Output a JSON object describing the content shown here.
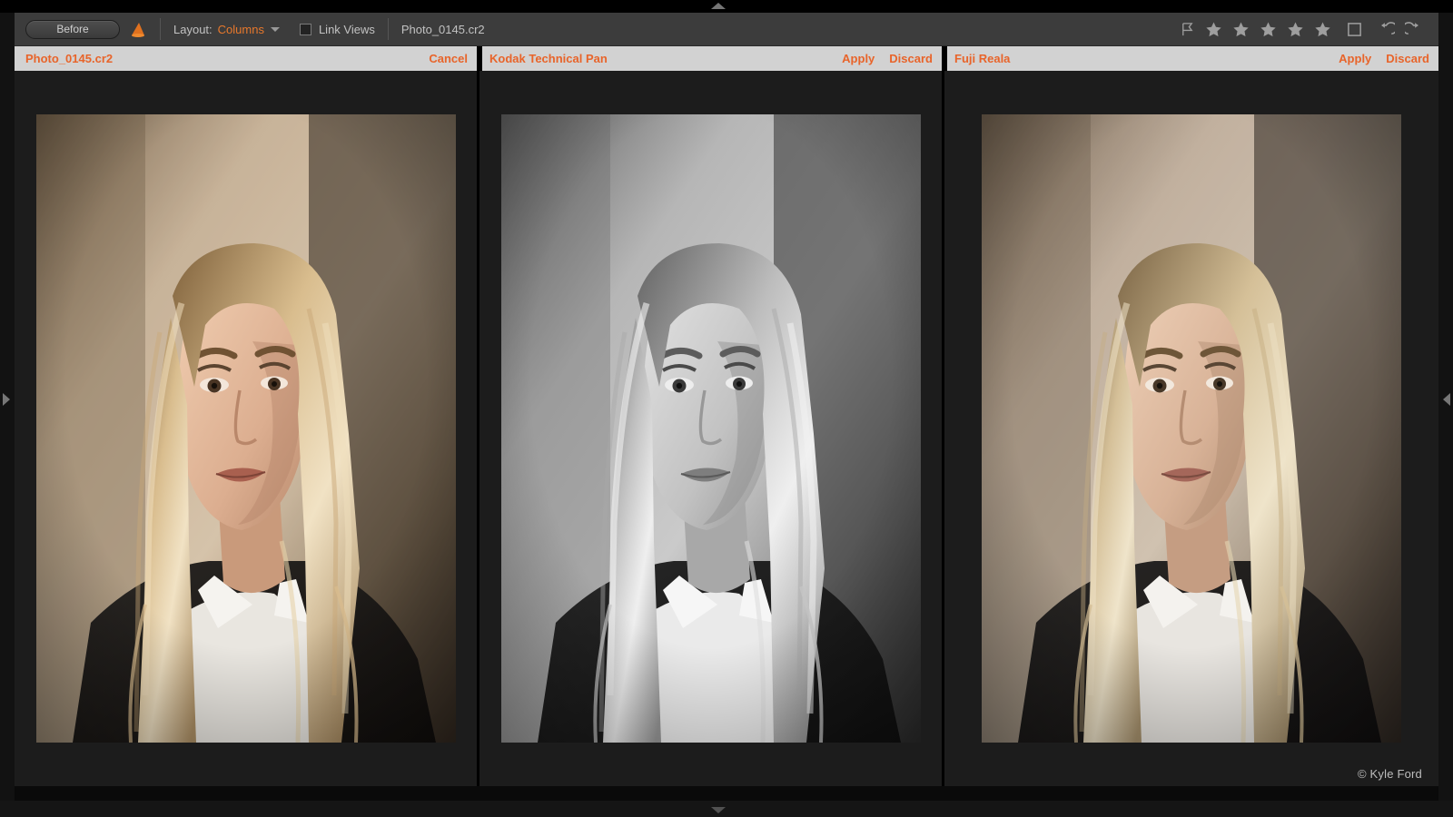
{
  "app": {
    "accent_orange": "#e8642a",
    "toolbar_bg": "#3c3c3c",
    "panel_header_bg": "#d2d2d2",
    "panel_body_bg": "#1c1c1c"
  },
  "toolbar": {
    "before_label": "Before",
    "cone_icon": "cone-icon",
    "layout_label": "Layout:",
    "layout_value": "Columns",
    "layout_chevron": "chevron-down-icon",
    "link_views_label": "Link Views",
    "link_views_checked": false,
    "filename": "Photo_0145.cr2",
    "right_icons": [
      {
        "name": "flag-icon",
        "glyph": "flag"
      },
      {
        "name": "star-icon-1",
        "glyph": "star"
      },
      {
        "name": "star-icon-2",
        "glyph": "star"
      },
      {
        "name": "star-icon-3",
        "glyph": "star"
      },
      {
        "name": "star-icon-4",
        "glyph": "star"
      },
      {
        "name": "star-icon-5",
        "glyph": "star"
      },
      {
        "name": "color-label-icon",
        "glyph": "square"
      },
      {
        "name": "undo-icon",
        "glyph": "undo"
      },
      {
        "name": "redo-icon",
        "glyph": "redo"
      }
    ],
    "rating_value": 5
  },
  "panels": [
    {
      "title": "Photo_0145.cr2",
      "actions": [
        "Cancel"
      ],
      "photo_name": "portrait-original-color"
    },
    {
      "title": "Kodak Technical Pan",
      "actions": [
        "Apply",
        "Discard"
      ],
      "photo_name": "portrait-kodak-technical-pan-bw"
    },
    {
      "title": "Fuji Reala",
      "actions": [
        "Apply",
        "Discard"
      ],
      "photo_name": "portrait-fuji-reala-color"
    }
  ],
  "edges": {
    "top_handle": "panel-collapse-up-icon",
    "bottom_handle": "panel-collapse-down-icon",
    "left_handle": "panel-expand-right-icon",
    "right_handle": "panel-expand-left-icon"
  },
  "footer": {
    "copyright": "© Kyle Ford"
  }
}
